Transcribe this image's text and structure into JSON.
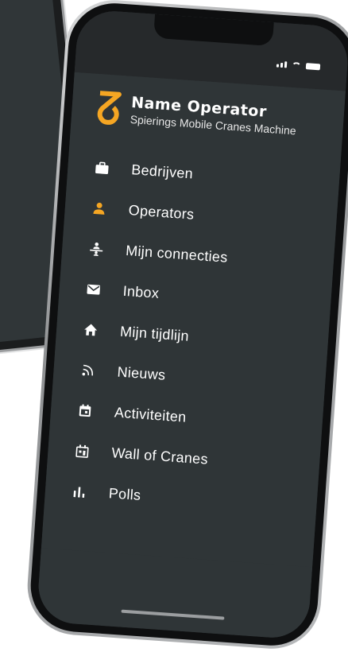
{
  "profile": {
    "name": "Name Operator",
    "subtitle": "Spierings Mobile Cranes Machine"
  },
  "menu": {
    "items": [
      {
        "label": "Bedrijven",
        "icon": "briefcase-icon"
      },
      {
        "label": "Operators",
        "icon": "person-icon"
      },
      {
        "label": "Mijn connecties",
        "icon": "connections-icon"
      },
      {
        "label": "Inbox",
        "icon": "mail-icon"
      },
      {
        "label": "Mijn tijdlijn",
        "icon": "home-icon"
      },
      {
        "label": "Nieuws",
        "icon": "rss-icon"
      },
      {
        "label": "Activiteiten",
        "icon": "calendar-icon"
      },
      {
        "label": "Wall of Cranes",
        "icon": "wall-icon"
      },
      {
        "label": "Polls",
        "icon": "bar-chart-icon"
      }
    ],
    "active_index": 1
  },
  "bottom_bar": {
    "icons": [
      "back-chevron-icon",
      "logo-tab-icon",
      "add-tab-icon",
      "settings-tab-icon",
      "monitor-tab-icon",
      "b-tab-icon"
    ]
  },
  "colors": {
    "accent": "#f5a623",
    "drawer_bg": "#2f3537",
    "bar_bg": "#262b2d",
    "text": "#ffffff",
    "muted_icon": "#3e4446"
  }
}
